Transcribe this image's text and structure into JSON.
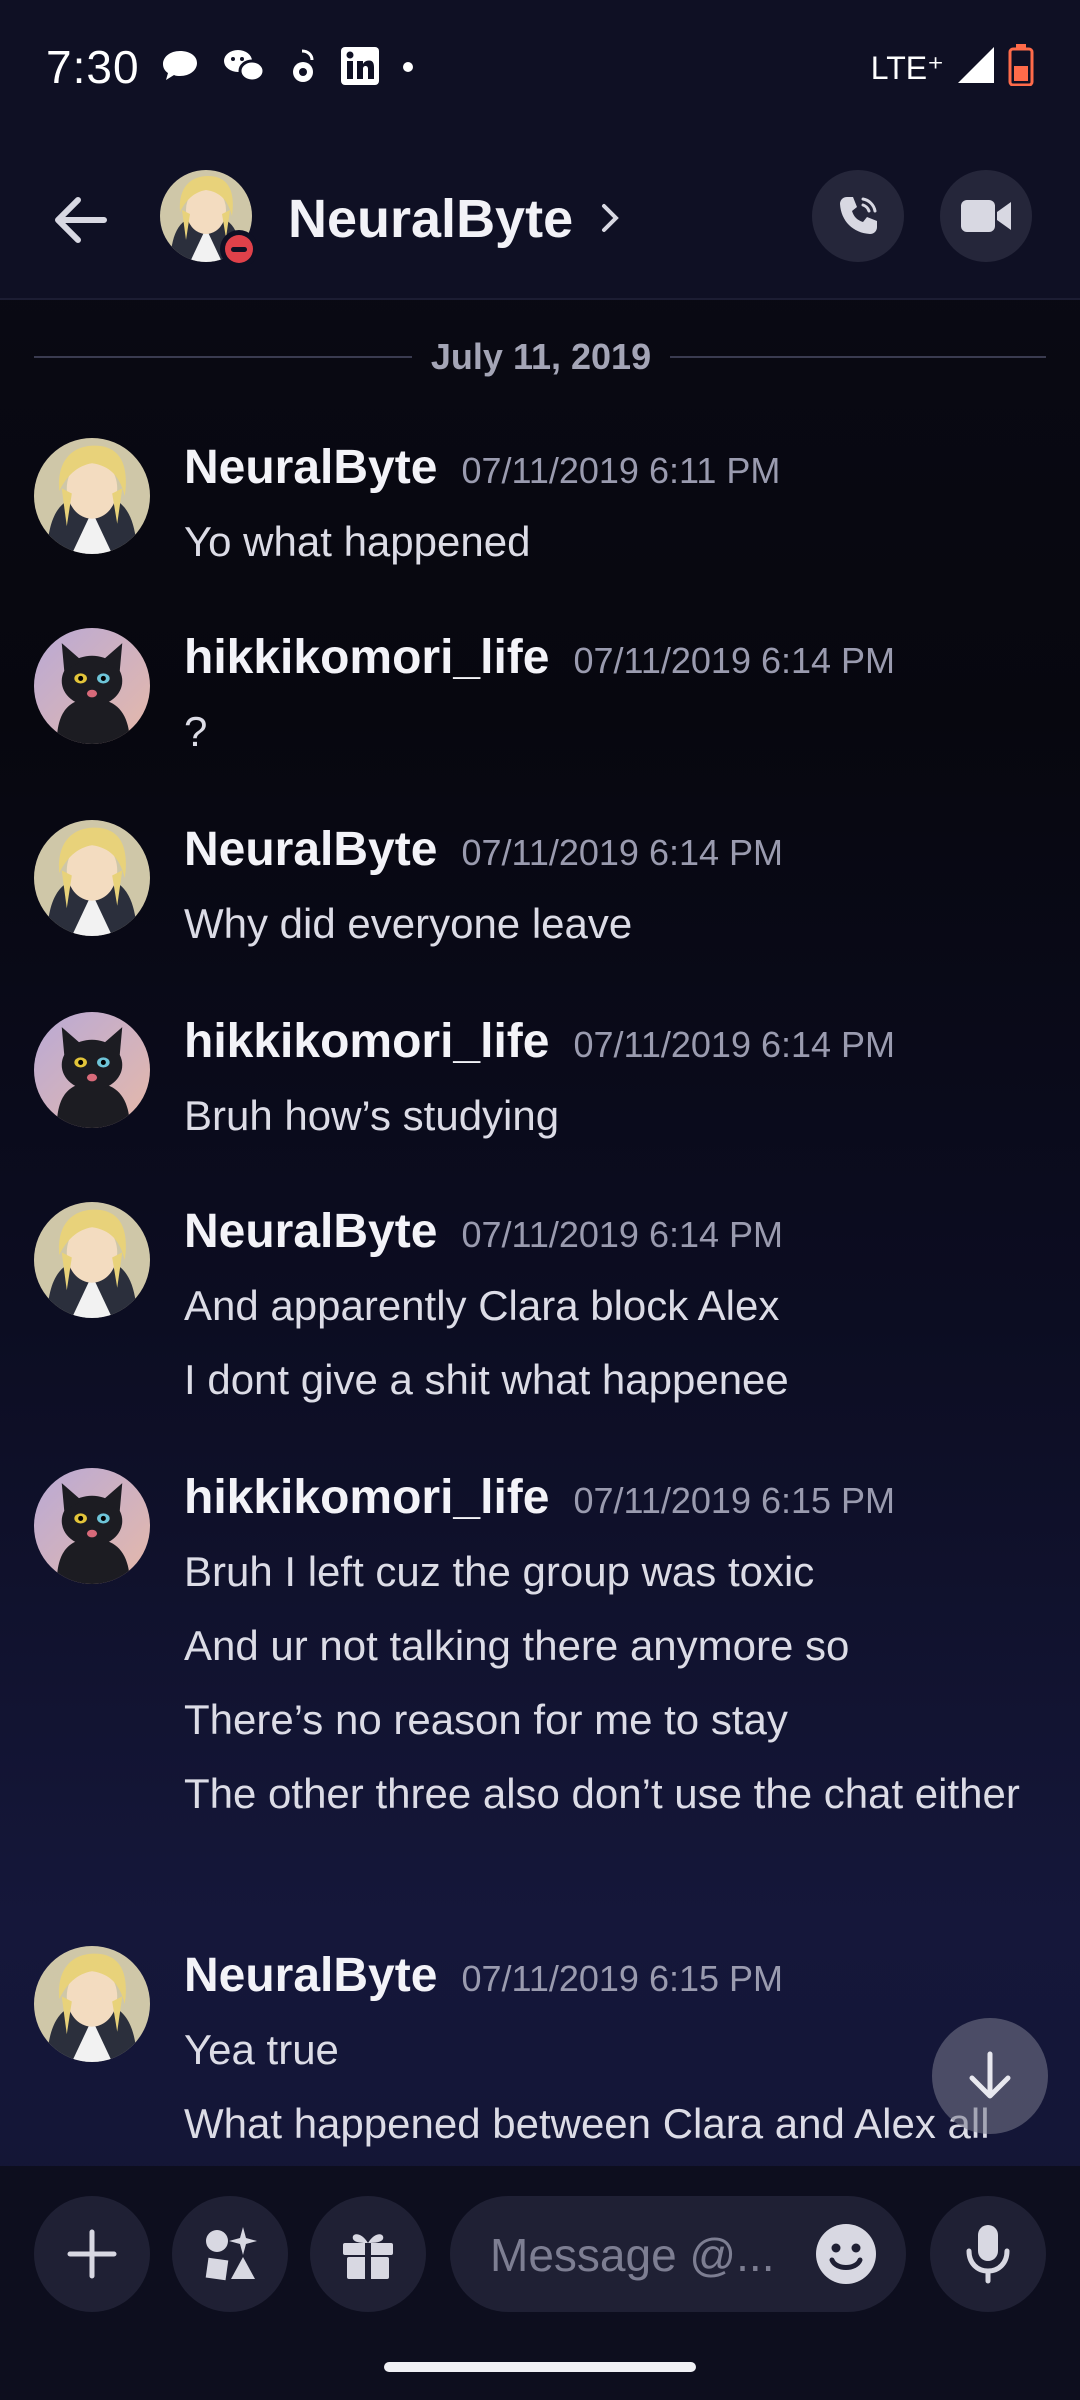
{
  "status_bar": {
    "time": "7:30",
    "network": "LTE⁺"
  },
  "header": {
    "title": "NeuralByte"
  },
  "date_divider": "July 11, 2019",
  "messages": [
    {
      "author": "NeuralByte",
      "time": "07/11/2019 6:11 PM",
      "lines": [
        "Yo what happened"
      ]
    },
    {
      "author": "hikkikomori_life",
      "time": "07/11/2019 6:14 PM",
      "lines": [
        "?"
      ]
    },
    {
      "author": "NeuralByte",
      "time": "07/11/2019 6:14 PM",
      "lines": [
        "Why did everyone leave"
      ]
    },
    {
      "author": "hikkikomori_life",
      "time": "07/11/2019 6:14 PM",
      "lines": [
        "Bruh how’s studying"
      ]
    },
    {
      "author": "NeuralByte",
      "time": "07/11/2019 6:14 PM",
      "lines": [
        "And apparently Clara block Alex",
        "I dont give a shit what happenee"
      ]
    },
    {
      "author": "hikkikomori_life",
      "time": "07/11/2019 6:15 PM",
      "lines": [
        "Bruh I left cuz the group was toxic",
        "And ur not talking there anymore so",
        "There’s no reason for me to stay",
        "The other three also don’t use the chat either"
      ]
    },
    {
      "author": "NeuralByte",
      "time": "07/11/2019 6:15 PM",
      "lines": [
        "Yea true",
        "What happened between Clara and Alex all"
      ]
    }
  ],
  "composer": {
    "placeholder": "Message @..."
  },
  "icons": {
    "back": "arrow-left-icon",
    "call": "phone-icon",
    "video": "video-camera-icon",
    "add": "plus-icon",
    "apps": "apps-icon",
    "gift": "gift-icon",
    "emoji": "emoji-icon",
    "mic": "microphone-icon",
    "jump": "arrow-down-icon"
  },
  "colors": {
    "background": "#0e0f1e",
    "dnd_status": "#e0414a",
    "battery": "#ff6b4a"
  }
}
